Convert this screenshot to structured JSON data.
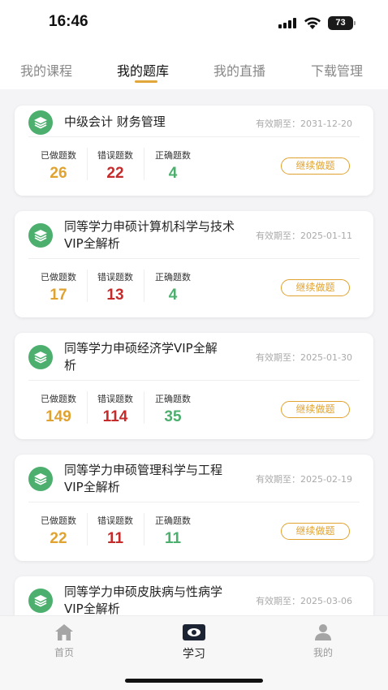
{
  "status_bar": {
    "time": "16:46",
    "battery": "73"
  },
  "tabs": [
    {
      "label": "我的课程"
    },
    {
      "label": "我的题库"
    },
    {
      "label": "我的直播"
    },
    {
      "label": "下载管理"
    }
  ],
  "labels": {
    "done": "已做题数",
    "wrong": "错误题数",
    "right": "正确题数",
    "continue": "继续做题"
  },
  "cards": [
    {
      "title": "中级会计 财务管理",
      "expire": "有效期至：2031-12-20",
      "done": "26",
      "wrong": "22",
      "right": "4"
    },
    {
      "title": "同等学力申硕计算机科学与技术VIP全解析",
      "expire": "有效期至：2025-01-11",
      "done": "17",
      "wrong": "13",
      "right": "4"
    },
    {
      "title": "同等学力申硕经济学VIP全解析",
      "expire": "有效期至：2025-01-30",
      "done": "149",
      "wrong": "114",
      "right": "35"
    },
    {
      "title": "同等学力申硕管理科学与工程VIP全解析",
      "expire": "有效期至：2025-02-19",
      "done": "22",
      "wrong": "11",
      "right": "11"
    },
    {
      "title": "同等学力申硕皮肤病与性病学VIP全解析",
      "expire": "有效期至：2025-03-06"
    }
  ],
  "bottom_nav": [
    {
      "label": "首页",
      "icon": "home-icon"
    },
    {
      "label": "学习",
      "icon": "study-icon"
    },
    {
      "label": "我的",
      "icon": "profile-icon"
    }
  ],
  "colors": {
    "accent": "#e1a73a",
    "done": "#e0a230",
    "wrong": "#c62b2b",
    "right": "#4caf6e",
    "icon_bg": "#4caf6e"
  }
}
